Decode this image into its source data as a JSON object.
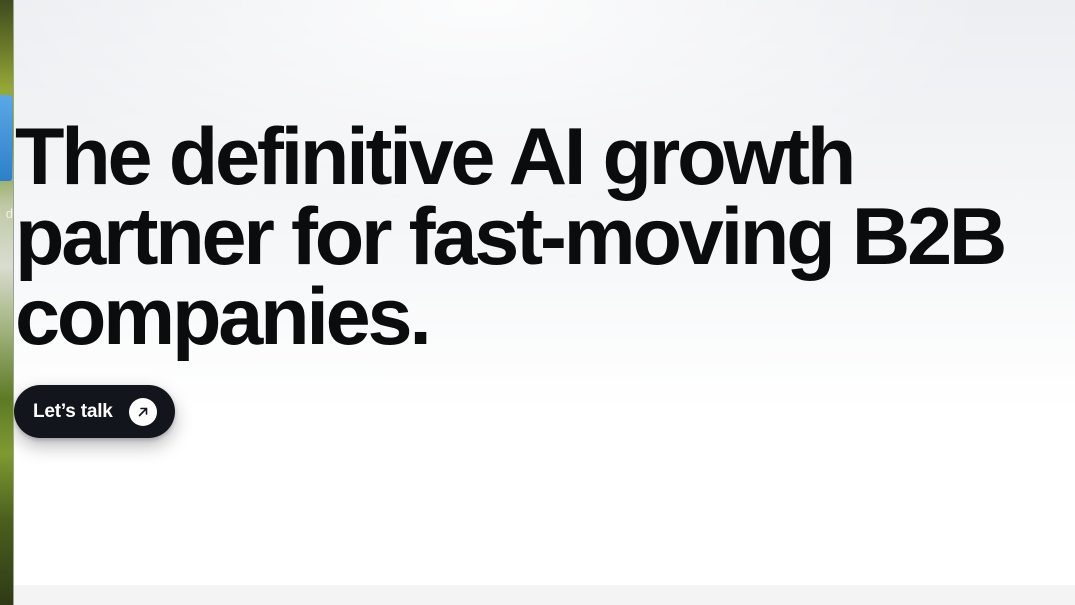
{
  "background_window": {
    "peek_text": "d"
  },
  "hero": {
    "heading_lines": [
      "The definitive AI growth",
      "partner for fast-moving B2B",
      "companies."
    ],
    "cta": {
      "label": "Let’s talk",
      "icon": "arrow-up-right-icon"
    }
  },
  "colors": {
    "heading": "#0b0c0e",
    "cta_background": "#13151d",
    "cta_text": "#ffffff",
    "page_background": "#ffffff"
  }
}
